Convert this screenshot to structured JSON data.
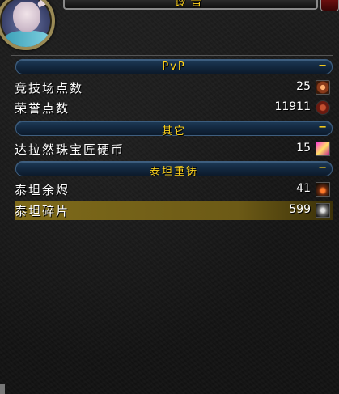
{
  "window": {
    "title": "铃音"
  },
  "sections": [
    {
      "header": "PvP",
      "toggle": "−",
      "items": [
        {
          "name": "竞技场点数",
          "count": "25",
          "icon": "arena-points-icon"
        },
        {
          "name": "荣誉点数",
          "count": "11911",
          "icon": "honor-points-icon"
        }
      ]
    },
    {
      "header": "其它",
      "toggle": "−",
      "items": [
        {
          "name": "达拉然珠宝匠硬币",
          "count": "15",
          "icon": "jewelcrafter-token-icon"
        }
      ]
    },
    {
      "header": "泰坦重铸",
      "toggle": "−",
      "items": [
        {
          "name": "泰坦余烬",
          "count": "41",
          "icon": "titan-ember-icon"
        },
        {
          "name": "泰坦碎片",
          "count": "599",
          "icon": "titan-shard-icon",
          "selected": true
        }
      ]
    }
  ]
}
